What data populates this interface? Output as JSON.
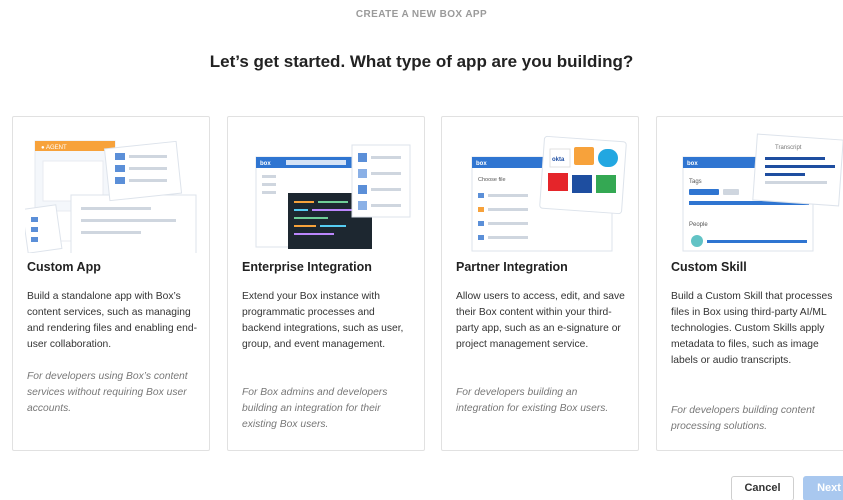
{
  "header": {
    "eyebrow": "CREATE A NEW BOX APP",
    "title": "Let’s get started. What type of app are you building?"
  },
  "cards": [
    {
      "title": "Custom App",
      "description": "Build a standalone app with Box’s content services, such as managing and rendering files and enabling end-user collaboration.",
      "note": "For developers using Box’s content services without requiring Box user accounts.",
      "illustration": "custom-app-illustration",
      "illustration_text": "● AGENT"
    },
    {
      "title": "Enterprise Integration",
      "description": "Extend your Box instance with programmatic processes and backend integrations, such as user, group, and event management.",
      "note": "For Box admins and developers building an integration for their existing Box users.",
      "illustration": "enterprise-integration-illustration",
      "illustration_text": "box"
    },
    {
      "title": "Partner Integration",
      "description": "Allow users to access, edit, and save their Box content within your third-party app, such as an e-signature or project management service.",
      "note": "For developers building an integration for existing Box users.",
      "illustration": "partner-integration-illustration",
      "illustration_text": "box",
      "illustration_subtext": "Choose file",
      "logo_okta": "okta"
    },
    {
      "title": "Custom Skill",
      "description": "Build a Custom Skill that processes files in Box using third-party AI/ML technologies. Custom Skills apply metadata to files, such as image labels or audio transcripts.",
      "note": "For developers building content processing solutions.",
      "illustration": "custom-skill-illustration",
      "illustration_text": "box",
      "illustration_tags": "Tags",
      "illustration_people": "People",
      "illustration_transcript": "Transcript"
    }
  ],
  "footer": {
    "cancel_label": "Cancel",
    "next_label": "Next"
  },
  "colors": {
    "box_blue": "#0061d5",
    "next_disabled": "#a9c8ef",
    "agent_orange": "#f7a23b"
  }
}
